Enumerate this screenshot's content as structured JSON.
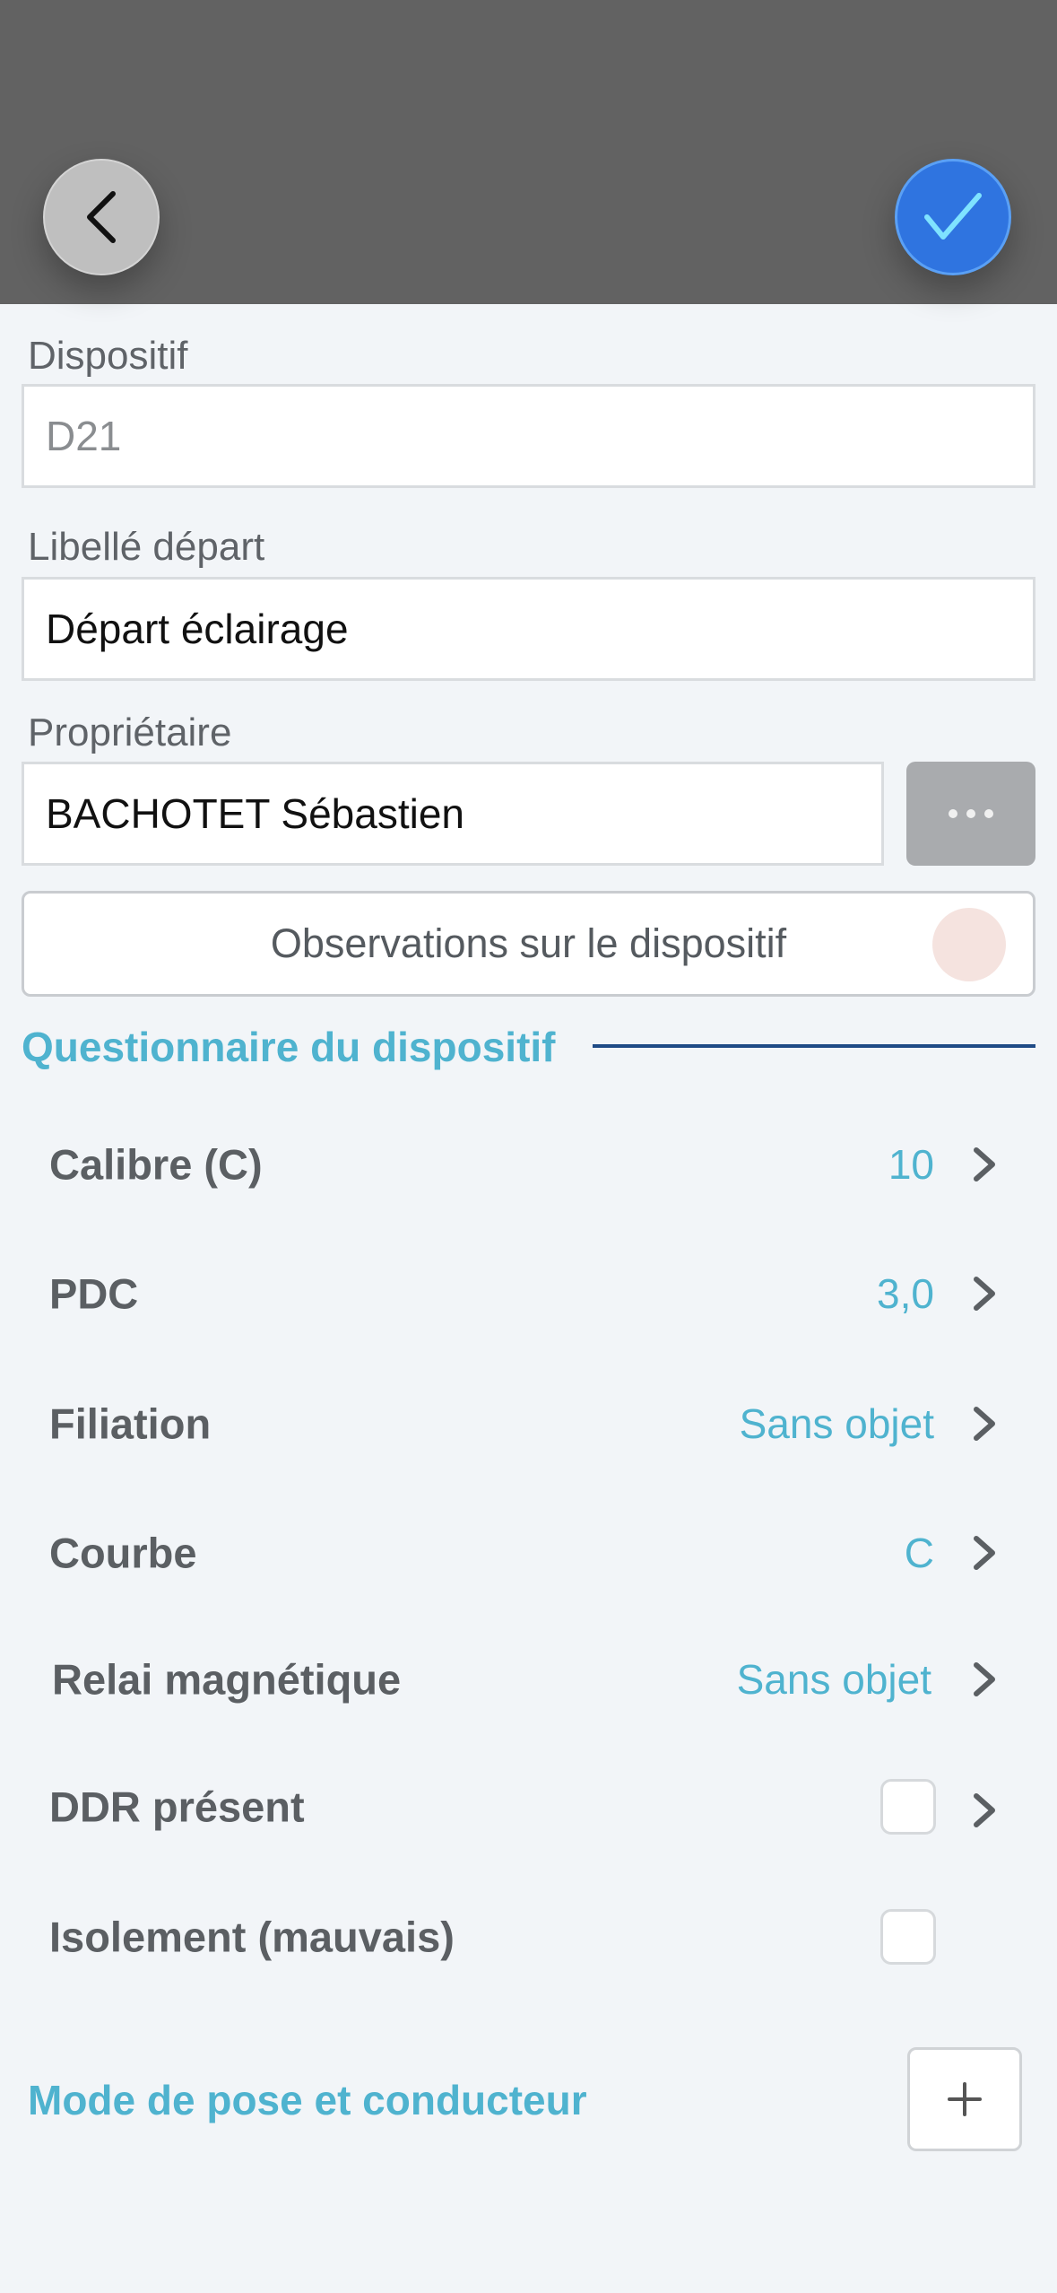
{
  "header": {
    "back_icon": "chevron-left-icon",
    "confirm_icon": "check-icon",
    "confirm_color": "#2f74e0"
  },
  "form": {
    "dispositif": {
      "label": "Dispositif",
      "value": "D21"
    },
    "libelle_depart": {
      "label": "Libellé départ",
      "value": "Départ éclairage"
    },
    "proprietaire": {
      "label": "Propriétaire",
      "value": "BACHOTET Sébastien",
      "more_icon": "ellipsis-icon"
    },
    "observations_button": "Observations sur le dispositif"
  },
  "questionnaire": {
    "title": "Questionnaire du dispositif",
    "rows": [
      {
        "label": "Calibre (C)",
        "value": "10"
      },
      {
        "label": "PDC",
        "value": "3,0"
      },
      {
        "label": "Filiation",
        "value": "Sans objet"
      },
      {
        "label": "Courbe",
        "value": "C"
      },
      {
        "label": "Relai magnétique",
        "value": "Sans objet"
      },
      {
        "label": "DDR présent",
        "checked": false
      },
      {
        "label": "Isolement (mauvais)",
        "checked": false
      }
    ]
  },
  "mode_pose": {
    "title": "Mode de pose et conducteur",
    "add_icon": "plus-icon"
  },
  "colors": {
    "accent": "#4fb3cf",
    "section_line": "#1f4b86",
    "header_bg": "#626262"
  }
}
